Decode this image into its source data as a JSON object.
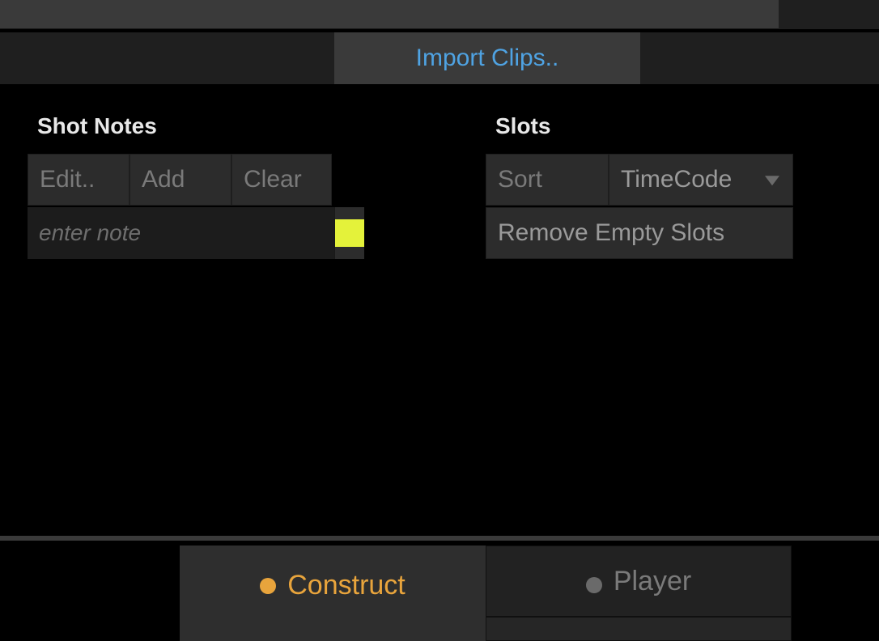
{
  "toolbar": {
    "import_label": "Import Clips.."
  },
  "shot_notes": {
    "heading": "Shot Notes",
    "edit_label": "Edit..",
    "add_label": "Add",
    "clear_label": "Clear",
    "note_placeholder": "enter note",
    "note_value": "",
    "swatch_color": "#e4f23a"
  },
  "slots": {
    "heading": "Slots",
    "sort_label": "Sort",
    "sort_value": "TimeCode",
    "remove_empty_label": "Remove Empty Slots"
  },
  "tabs": {
    "construct_label": "Construct",
    "player_label": "Player",
    "active": "construct"
  }
}
